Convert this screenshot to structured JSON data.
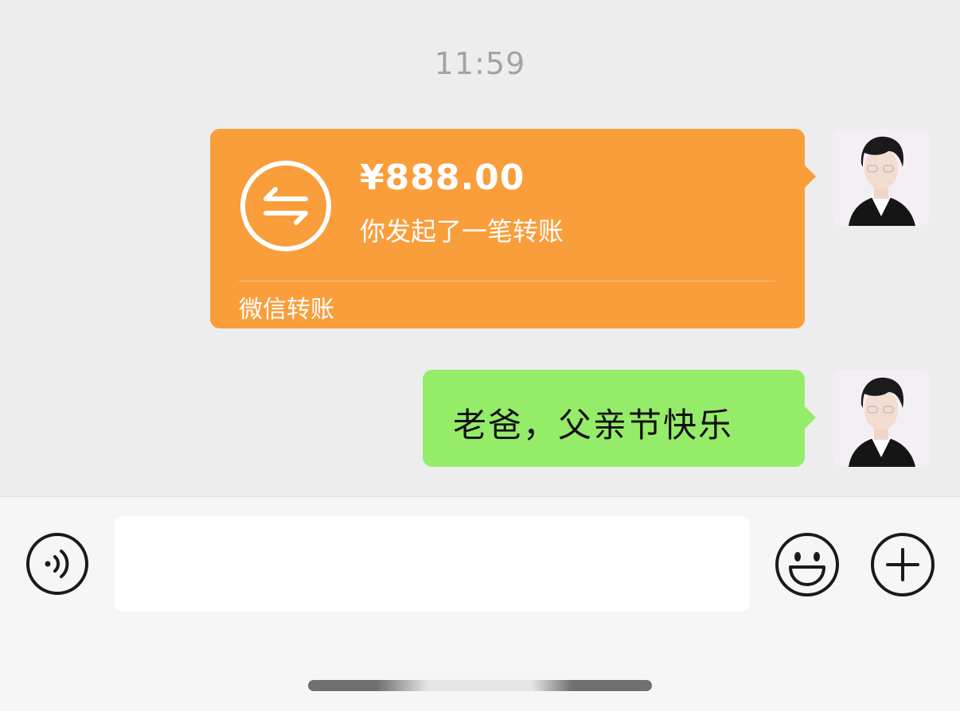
{
  "chat": {
    "timestamp": "11:59"
  },
  "transfer_message": {
    "amount": "¥888.00",
    "description": "你发起了一笔转账",
    "footer": "微信转账",
    "bubble_color": "#f99e3b"
  },
  "text_message": {
    "text": "老爸，父亲节快乐",
    "bubble_color": "#95ec69"
  },
  "input_bar": {
    "input_value": "",
    "voice_icon": "voice-icon",
    "emoji_icon": "emoji-icon",
    "plus_icon": "plus-icon"
  }
}
